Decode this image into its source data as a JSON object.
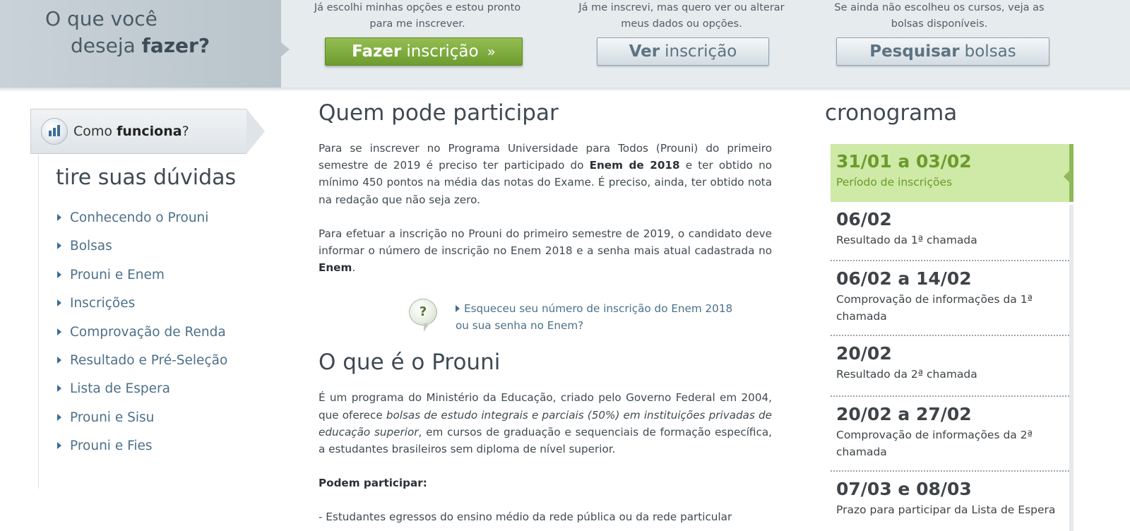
{
  "header": {
    "prompt_line1": "O que você",
    "prompt_line2_pre": "deseja ",
    "prompt_line2_bold": "fazer?",
    "actions": [
      {
        "desc_line1": "Já escolhi minhas opções e estou pronto",
        "desc_line2": "para me inscrever.",
        "button_bold": "Fazer",
        "button_rest": "inscrição",
        "button_icon": "»"
      },
      {
        "desc_line1": "Já me inscrevi, mas quero ver ou alterar",
        "desc_line2": "meus dados ou opções.",
        "button_bold": "Ver",
        "button_rest": "inscrição"
      },
      {
        "desc_line1": "Se ainda não escolheu os cursos, veja as",
        "desc_line2": "bolsas disponíveis.",
        "button_bold": "Pesquisar",
        "button_rest": "bolsas"
      }
    ]
  },
  "sidebar": {
    "how_tab_pre": "Como ",
    "how_tab_bold": "funciona",
    "how_tab_post": "?",
    "title": "tire suas dúvidas",
    "items": [
      "Conhecendo o Prouni",
      "Bolsas",
      "Prouni e Enem",
      "Inscrições",
      "Comprovação de Renda",
      "Resultado e Pré-Seleção",
      "Lista de Espera",
      "Prouni e Sisu",
      "Prouni e Fies"
    ]
  },
  "main": {
    "section1_title": "Quem pode participar",
    "p1_a": "Para se inscrever no Programa Universidade para Todos (Prouni) do primeiro semestre de 2019 é preciso ter participado do ",
    "p1_bold": "Enem de 2018",
    "p1_b": " e ter obtido no mínimo 450 pontos na média das notas do Exame. É preciso, ainda, ter obtido nota na redação que não seja zero.",
    "p2_a": "Para efetuar a inscrição no Prouni do primeiro semestre de 2019, o candidato deve informar o número de inscrição no Enem 2018 e a senha mais atual cadastrada no ",
    "p2_bold": "Enem",
    "p2_b": ".",
    "help_icon": "?",
    "forgot_line1": "Esqueceu seu número de inscrição do Enem 2018",
    "forgot_line2": "ou sua senha no Enem?",
    "section2_title": "O que é o Prouni",
    "p3_a": "É um programa do Ministério da Educação, criado pelo Governo Federal em 2004, que oferece ",
    "p3_italic": "bolsas de estudo integrais e parciais (50%) em instituições privadas de educação superior",
    "p3_b": ", em cursos de graduação e sequenciais de formação específica, a estudantes brasileiros sem diploma de nível superior.",
    "p4_bold": "Podem participar:",
    "p5": "- Estudantes egressos do ensino médio da rede pública ou da rede particular"
  },
  "cronograma": {
    "title": "cronograma",
    "items": [
      {
        "date": "31/01 a 03/02",
        "desc": "Período de inscrições",
        "active": true
      },
      {
        "date": "06/02",
        "desc": "Resultado da 1ª chamada"
      },
      {
        "date": "06/02 a 14/02",
        "desc": "Comprovação de informações da 1ª chamada"
      },
      {
        "date": "20/02",
        "desc": "Resultado da 2ª chamada"
      },
      {
        "date": "20/02 a 27/02",
        "desc": "Comprovação de informações da 2ª chamada"
      },
      {
        "date": "07/03 e 08/03",
        "desc": "Prazo para participar da Lista de Espera"
      }
    ]
  },
  "colors": {
    "accent_green": "#6e9c2f",
    "active_bg": "#cfe9a6",
    "link_blue": "#4c7089",
    "header_bg": "#e6ebee"
  },
  "icons": {
    "how_tab": "bar-chart-icon",
    "list_bullet": "triangle-right-icon",
    "help": "question-bubble-icon",
    "button_arrow": "double-chevron-right-icon"
  }
}
